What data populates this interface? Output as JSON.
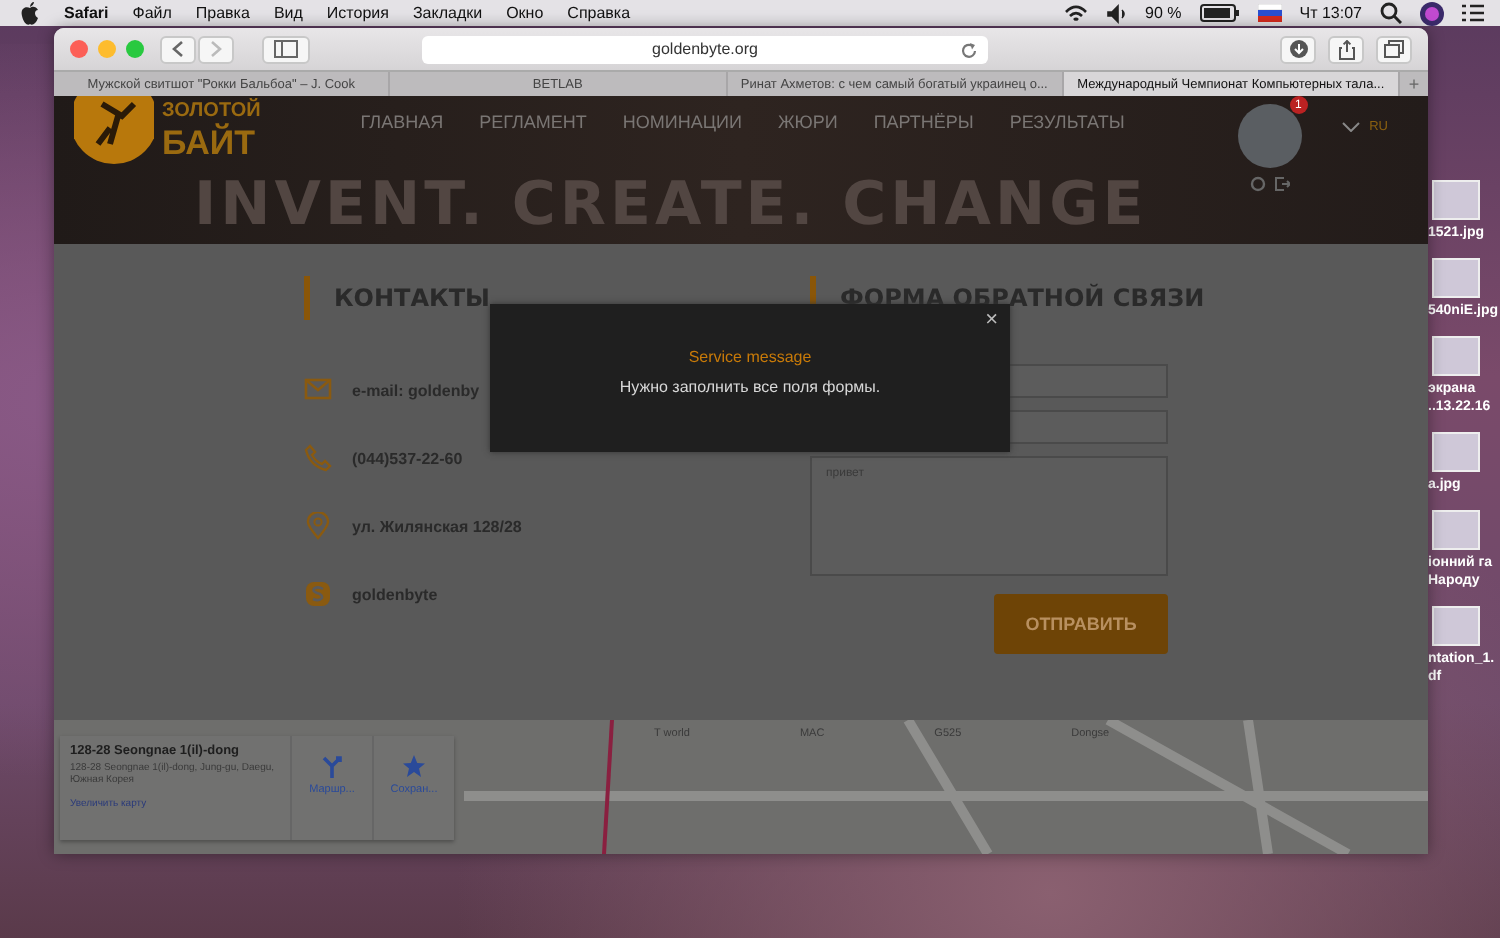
{
  "menu_bar": {
    "app": "Safari",
    "menus": [
      "Файл",
      "Правка",
      "Вид",
      "История",
      "Закладки",
      "Окно",
      "Справка"
    ],
    "battery": "90 %",
    "clock": "Чт 13:07"
  },
  "browser": {
    "address": "goldenbyte.org",
    "tabs": [
      {
        "label": "Мужской свитшот \"Рокки Бальбоа\" – J. Cook",
        "selected": false
      },
      {
        "label": "BETLAB",
        "selected": false
      },
      {
        "label": "Ринат Ахметов: с чем самый богатый украинец о...",
        "selected": false
      },
      {
        "label": "Международный Чемпионат Компьютерных тала...",
        "selected": true
      }
    ],
    "new_tab": "+"
  },
  "site": {
    "logo": [
      "ЗОЛОТОЙ",
      "БАЙТ"
    ],
    "nav": [
      "ГЛАВНАЯ",
      "РЕГЛАМЕНТ",
      "НОМИНАЦИИ",
      "ЖЮРИ",
      "ПАРТНЁРЫ",
      "РЕЗУЛЬТАТЫ"
    ],
    "notification_count": "1",
    "language": "RU",
    "banner": "INVENT. CREATE. CHANGE"
  },
  "contacts": {
    "title": "КОНТАКТЫ",
    "items": [
      {
        "kind": "email",
        "text": "e-mail: goldenby"
      },
      {
        "kind": "phone",
        "text": "(044)537-22-60"
      },
      {
        "kind": "address",
        "text": "ул. Жилянская 128/28"
      },
      {
        "kind": "skype",
        "text": "goldenbyte"
      }
    ]
  },
  "form": {
    "title": "ФОРМА ОБРАТНОЙ СВЯЗИ",
    "message_value": "привет",
    "submit": "ОТПРАВИТЬ"
  },
  "modal": {
    "title": "Service message",
    "message": "Нужно заполнить все поля формы.",
    "close": "×"
  },
  "map": {
    "place": "128-28 Seongnae 1(il)-dong",
    "address": "128-28 Seongnae 1(il)-dong, Jung-gu, Daegu, Южная Корея",
    "actions": [
      "Маршр...",
      "Сохран..."
    ],
    "link": "Увеличить карту",
    "labels": [
      "T world",
      "MAC",
      "G525",
      "Dongse"
    ]
  },
  "desktop_icons": [
    {
      "label": "1521.jpg"
    },
    {
      "label": "540niE.jpg"
    },
    {
      "label": "экрана ..13.22.16"
    },
    {
      "label": "a.jpg"
    },
    {
      "label": "іонний га Народу"
    },
    {
      "label": "ntation_1. df"
    }
  ]
}
